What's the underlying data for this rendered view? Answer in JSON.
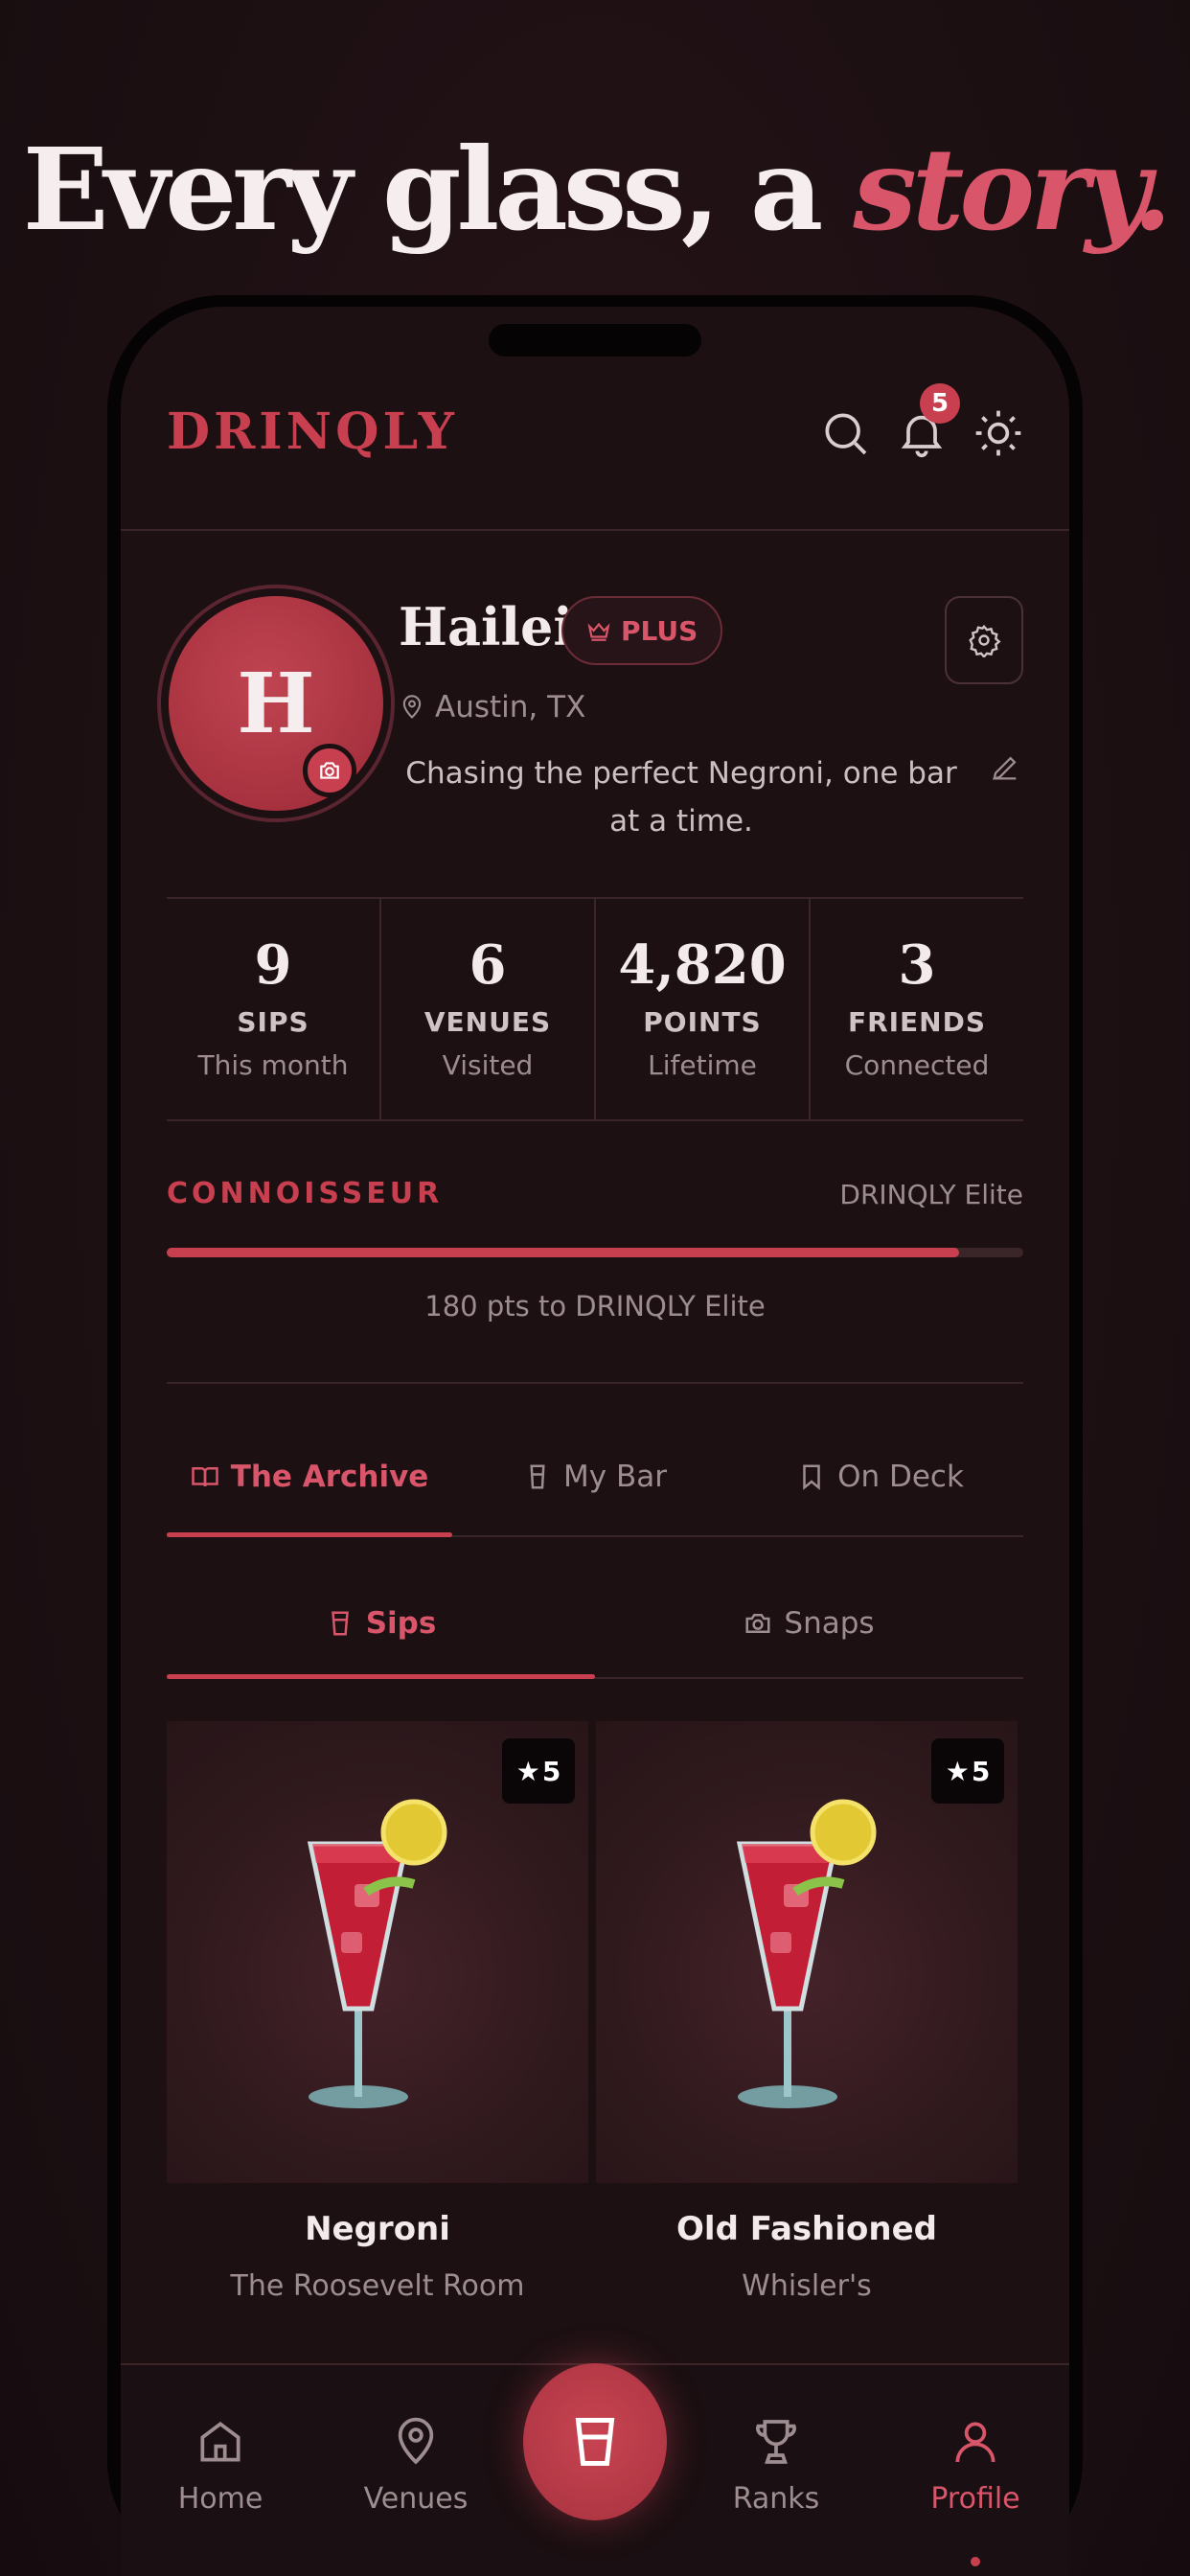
{
  "headline": {
    "text": "Every glass, a ",
    "accent": "story."
  },
  "header": {
    "logo": "DRINQLY",
    "notification_count": "5"
  },
  "profile": {
    "initial": "H",
    "name": "Hailei",
    "badge": "PLUS",
    "location": "Austin, TX",
    "bio": "Chasing the perfect Negroni, one bar at a time."
  },
  "stats": [
    {
      "value": "9",
      "label": "SIPS",
      "sub": "This month"
    },
    {
      "value": "6",
      "label": "VENUES",
      "sub": "Visited"
    },
    {
      "value": "4,820",
      "label": "POINTS",
      "sub": "Lifetime"
    },
    {
      "value": "3",
      "label": "FRIENDS",
      "sub": "Connected"
    }
  ],
  "tier": {
    "current": "CONNOISSEUR",
    "next": "DRINQLY Elite",
    "progress_fraction": 0.925,
    "progress_text": "180 pts to DRINQLY Elite"
  },
  "tabs": [
    {
      "label": "The Archive",
      "icon": "book-open-icon",
      "active": true
    },
    {
      "label": "My Bar",
      "icon": "bottle-icon",
      "active": false
    },
    {
      "label": "On Deck",
      "icon": "bookmark-icon",
      "active": false
    }
  ],
  "subtabs": [
    {
      "label": "Sips",
      "icon": "glass-icon",
      "active": true
    },
    {
      "label": "Snaps",
      "icon": "camera-icon",
      "active": false
    }
  ],
  "cards": [
    {
      "rating": "5",
      "title": "Negroni",
      "venue": "The Roosevelt Room"
    },
    {
      "rating": "5",
      "title": "Old Fashioned",
      "venue": "Whisler's"
    }
  ],
  "nav": [
    {
      "label": "Home",
      "icon": "home-icon"
    },
    {
      "label": "Venues",
      "icon": "map-pin-icon"
    },
    {
      "label": "Ranks",
      "icon": "trophy-icon"
    },
    {
      "label": "Profile",
      "icon": "user-icon",
      "active": true
    }
  ],
  "colors": {
    "accent": "#c8404f",
    "background": "#1c1013",
    "text": "#f3eaeb",
    "muted": "#9d8d91"
  }
}
